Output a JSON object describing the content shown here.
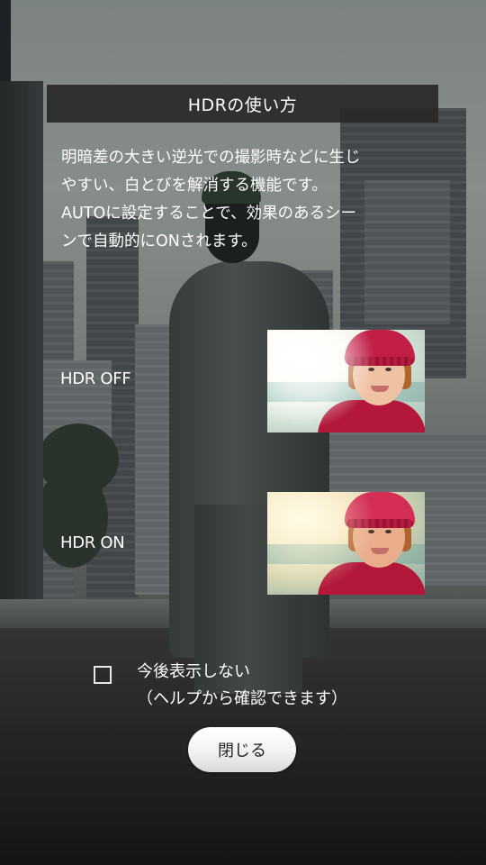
{
  "dialog": {
    "title": "HDRの使い方",
    "description_lines": [
      "明暗差の大きい逆光での撮影時などに生じ",
      "やすい、白とびを解消する機能です。",
      "AUTOに設定することで、効果のあるシー",
      "ンで自動的にONされます。"
    ],
    "examples": [
      {
        "label": "HDR OFF",
        "image": "girl-backlit-photo-washed-out"
      },
      {
        "label": "HDR ON",
        "image": "girl-backlit-photo-corrected"
      }
    ],
    "dont_show_again": {
      "checked": false,
      "label_line1": "今後表示しない",
      "label_line2": "（ヘルプから確認できます）"
    },
    "close_label": "閉じる"
  },
  "colors": {
    "title_bar": "#282828",
    "text": "#ffffff",
    "button_bg": "#f2f2f2",
    "button_text": "#222222"
  }
}
